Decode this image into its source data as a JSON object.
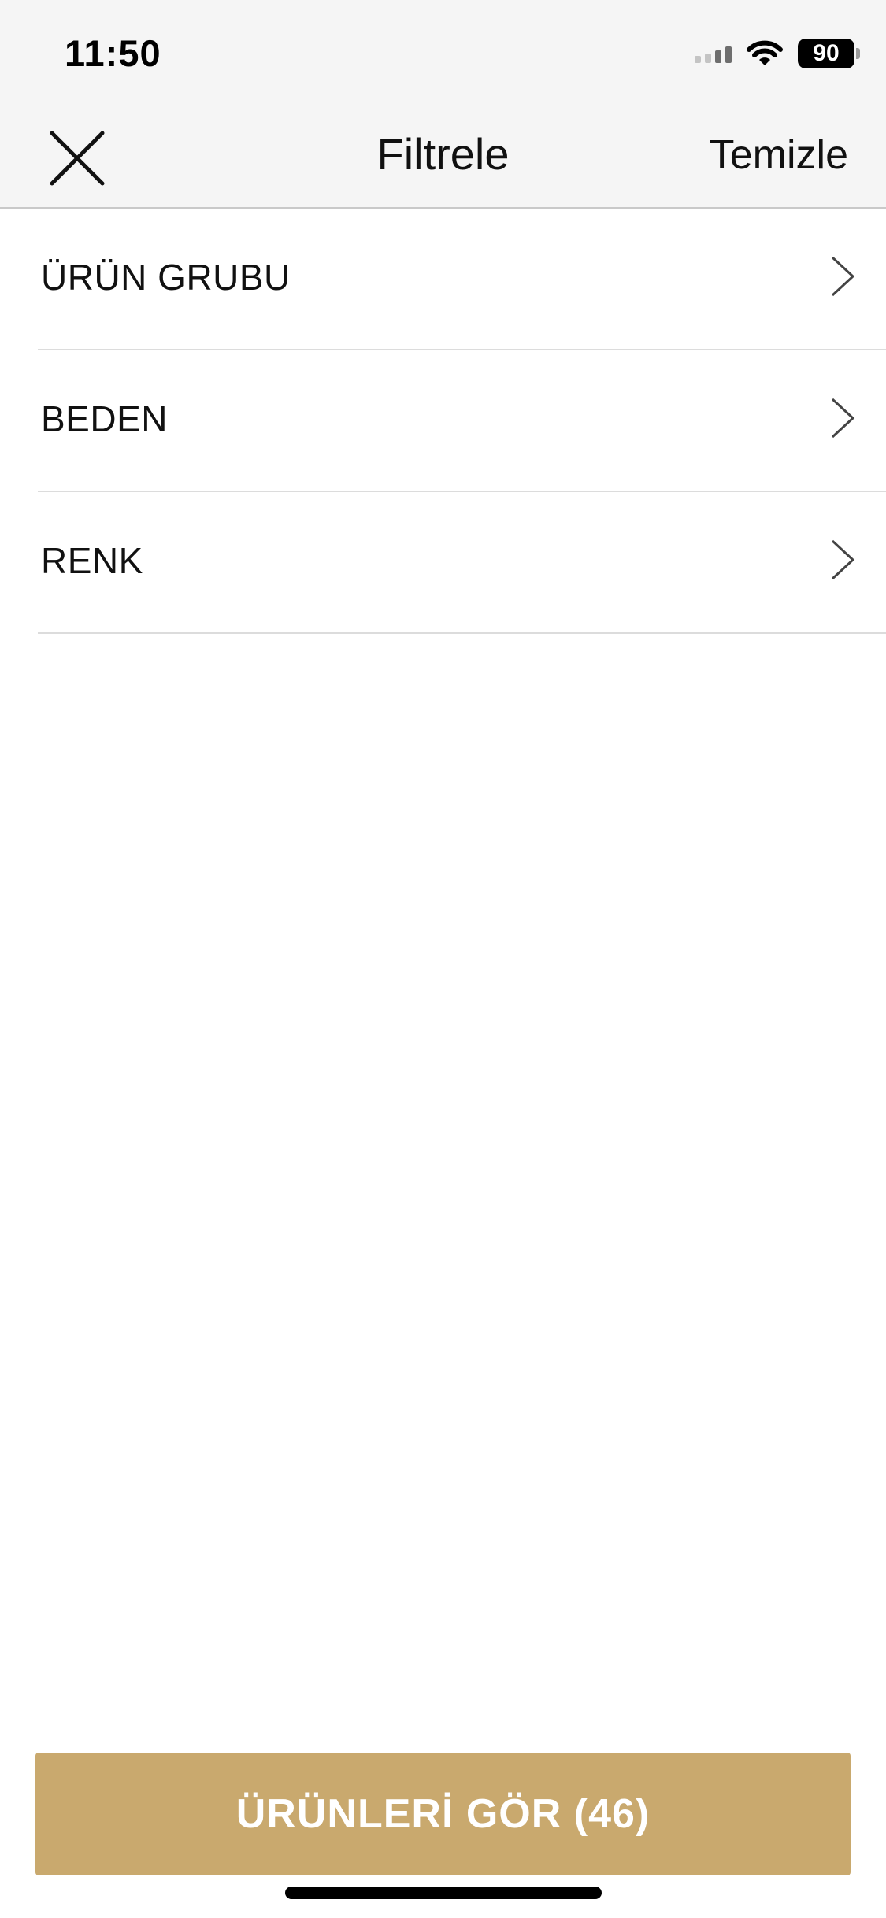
{
  "status_bar": {
    "time": "11:50",
    "battery_level": "90",
    "icons": [
      "cellular-signal-icon",
      "wifi-icon",
      "battery-icon"
    ]
  },
  "nav": {
    "title": "Filtrele",
    "clear_label": "Temizle",
    "close_icon": "close-icon"
  },
  "filters": [
    {
      "label": "ÜRÜN GRUBU",
      "icon": "chevron-right-icon"
    },
    {
      "label": "BEDEN",
      "icon": "chevron-right-icon"
    },
    {
      "label": "RENK",
      "icon": "chevron-right-icon"
    }
  ],
  "apply_button": {
    "label": "ÜRÜNLERİ GÖR (46)"
  },
  "colors": {
    "accent": "#c9a96e",
    "header_background": "#f5f5f5",
    "divider": "#dcdcdc"
  }
}
